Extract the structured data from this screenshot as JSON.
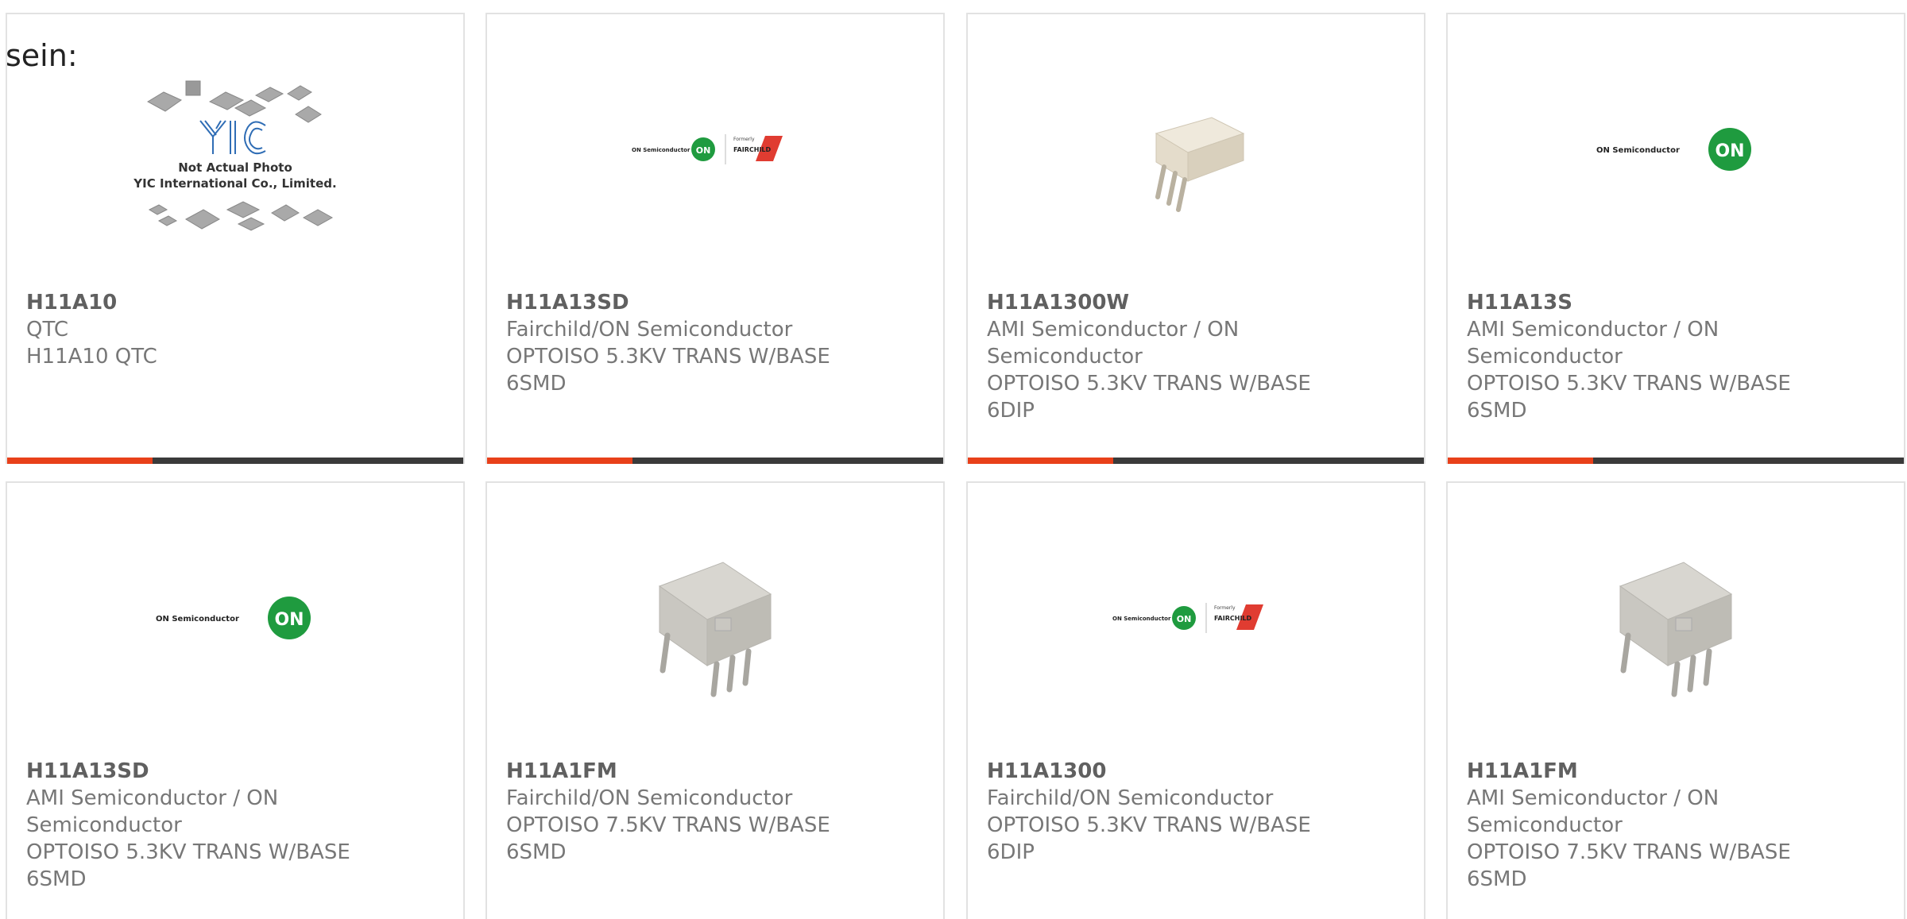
{
  "header_fragment": "sein:",
  "colors": {
    "accent": "#e8401a",
    "bar": "#3a3a3a",
    "on_green": "#1f9b3f",
    "fairchild_red": "#e03c31"
  },
  "placeholder_image": {
    "line1": "Not Actual Photo",
    "line2": "YIC International Co., Limited.",
    "logo": "YIC"
  },
  "logos": {
    "on_semi": "ON Semiconductor",
    "on_badge": "ON",
    "fairchild_formerly": "Formerly",
    "fairchild": "FAIRCHILD"
  },
  "products": [
    {
      "part": "H11A10",
      "lines": [
        "QTC",
        "H11A10 QTC"
      ],
      "image": "yic-placeholder"
    },
    {
      "part": "H11A13SD",
      "lines": [
        "Fairchild/ON Semiconductor",
        "OPTOISO 5.3KV TRANS W/BASE",
        "6SMD"
      ],
      "image": "on-fairchild-logo"
    },
    {
      "part": "H11A1300W",
      "lines": [
        "AMI Semiconductor / ON",
        "Semiconductor",
        "OPTOISO 5.3KV TRANS W/BASE",
        "6DIP"
      ],
      "image": "dip-chip-small"
    },
    {
      "part": "H11A13S",
      "lines": [
        "AMI Semiconductor / ON",
        "Semiconductor",
        "OPTOISO 5.3KV TRANS W/BASE",
        "6SMD"
      ],
      "image": "on-logo"
    },
    {
      "part": "H11A13SD",
      "lines": [
        "AMI Semiconductor / ON",
        "Semiconductor",
        "OPTOISO 5.3KV TRANS W/BASE",
        "6SMD"
      ],
      "image": "on-logo"
    },
    {
      "part": "H11A1FM",
      "lines": [
        "Fairchild/ON Semiconductor",
        "OPTOISO 7.5KV TRANS W/BASE",
        "6SMD"
      ],
      "image": "dip-chip-large"
    },
    {
      "part": "H11A1300",
      "lines": [
        "Fairchild/ON Semiconductor",
        "OPTOISO 5.3KV TRANS W/BASE",
        "6DIP"
      ],
      "image": "on-fairchild-logo"
    },
    {
      "part": "H11A1FM",
      "lines": [
        "AMI Semiconductor / ON",
        "Semiconductor",
        "OPTOISO 7.5KV TRANS W/BASE",
        "6SMD"
      ],
      "image": "dip-chip-large"
    }
  ]
}
